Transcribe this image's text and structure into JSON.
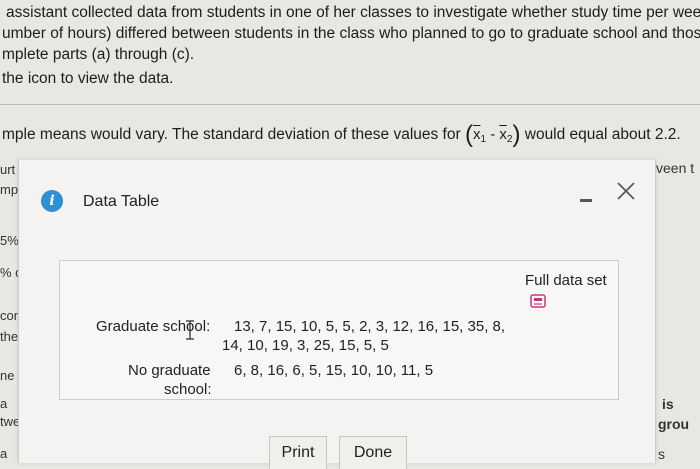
{
  "background": {
    "lines": [
      "assistant collected data from students in one of her classes to investigate whether study time per wee",
      "umber of hours) differed between students in the class who planned to go to graduate school and thos",
      "mplete parts (a) through (c).",
      "the icon to view the data."
    ],
    "sentence_start": "mple means would vary. The standard deviation of these values for",
    "formula": {
      "x1": "x",
      "sub1": "1",
      "minus": "-",
      "x2": "x",
      "sub2": "2"
    },
    "sentence_end": "would equal about 2.2.",
    "left_edge_fragments": [
      "urt",
      "mp",
      "5%",
      "% c",
      "con",
      "the",
      "ne",
      "a",
      "twe",
      "a"
    ],
    "right_edge_fragments": [
      "veen t",
      "is",
      "grou",
      "s"
    ]
  },
  "dialog": {
    "title": "Data Table",
    "panel": {
      "full_data_label": "Full data set",
      "row1_label": "Graduate school:",
      "row1_line1": "13, 7, 15, 10, 5, 5, 2, 3, 12, 16, 15, 35, 8,",
      "row1_line2": "14, 10, 19, 3, 25, 15, 5, 5",
      "row2_label_line1": "No graduate",
      "row2_label_line2": "school:",
      "row2_values": "6, 8, 16, 6, 5, 15, 10, 10, 11, 5"
    },
    "buttons": {
      "print": "Print",
      "done": "Done"
    }
  },
  "colors": {
    "info_blue": "#2f8fd3",
    "icon_pink": "#c8367a",
    "background": "#e9e7e4"
  }
}
